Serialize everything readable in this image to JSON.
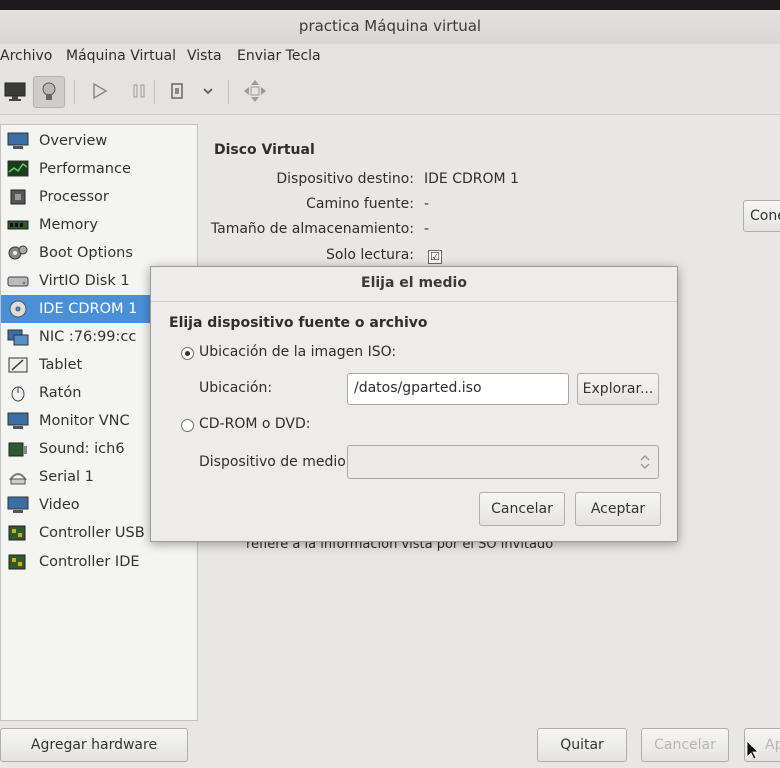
{
  "window": {
    "title": "practica Máquina virtual"
  },
  "menu": [
    "Archivo",
    "Máquina Virtual",
    "Vista",
    "Enviar Tecla"
  ],
  "toolbar": {
    "icons": [
      "monitor-icon",
      "lightbulb-icon",
      "play-icon",
      "pause-icon",
      "stop-icon",
      "chevron-down-icon",
      "move-icon"
    ]
  },
  "sidebar": {
    "items": [
      {
        "label": "Overview",
        "icon": "overview-icon"
      },
      {
        "label": "Performance",
        "icon": "performance-icon"
      },
      {
        "label": "Processor",
        "icon": "processor-icon"
      },
      {
        "label": "Memory",
        "icon": "memory-icon"
      },
      {
        "label": "Boot Options",
        "icon": "gears-icon"
      },
      {
        "label": "VirtIO Disk 1",
        "icon": "disk-icon"
      },
      {
        "label": "IDE CDROM 1",
        "icon": "cdrom-icon",
        "selected": true
      },
      {
        "label": "NIC :76:99:cc",
        "icon": "nic-icon"
      },
      {
        "label": "Tablet",
        "icon": "tablet-icon"
      },
      {
        "label": "Ratón",
        "icon": "mouse-icon"
      },
      {
        "label": "Monitor VNC",
        "icon": "monitor-icon"
      },
      {
        "label": "Sound: ich6",
        "icon": "sound-icon"
      },
      {
        "label": "Serial 1",
        "icon": "serial-icon"
      },
      {
        "label": "Video",
        "icon": "video-icon"
      },
      {
        "label": "Controller USB",
        "icon": "controller-icon"
      },
      {
        "label": "Controller IDE",
        "icon": "controller-icon"
      }
    ]
  },
  "details": {
    "heading": "Disco Virtual",
    "rows": [
      {
        "label": "Dispositivo destino:",
        "value": "IDE CDROM 1"
      },
      {
        "label": "Camino fuente:",
        "value": "-"
      },
      {
        "label": "Tamaño de almacenamiento:",
        "value": "-"
      },
      {
        "label": "Solo lectura:",
        "value": "☑"
      }
    ],
    "connect_button": "Cone",
    "note": "refiere a la información vista por el SO invitado"
  },
  "dialog": {
    "title": "Elija el medio",
    "heading": "Elija dispositivo fuente o archivo",
    "iso_option": "Ubicación de la imagen ISO:",
    "location_label": "Ubicación:",
    "location_value": "/datos/gparted.iso",
    "browse_button": "Explorar...",
    "cdrom_option": "CD-ROM o DVD:",
    "device_label": "Dispositivo de medio:",
    "cancel_button": "Cancelar",
    "accept_button": "Aceptar"
  },
  "footer": {
    "add_hardware": "Agregar hardware",
    "quit": "Quitar",
    "cancel": "Cancelar",
    "apply": "Ap"
  }
}
